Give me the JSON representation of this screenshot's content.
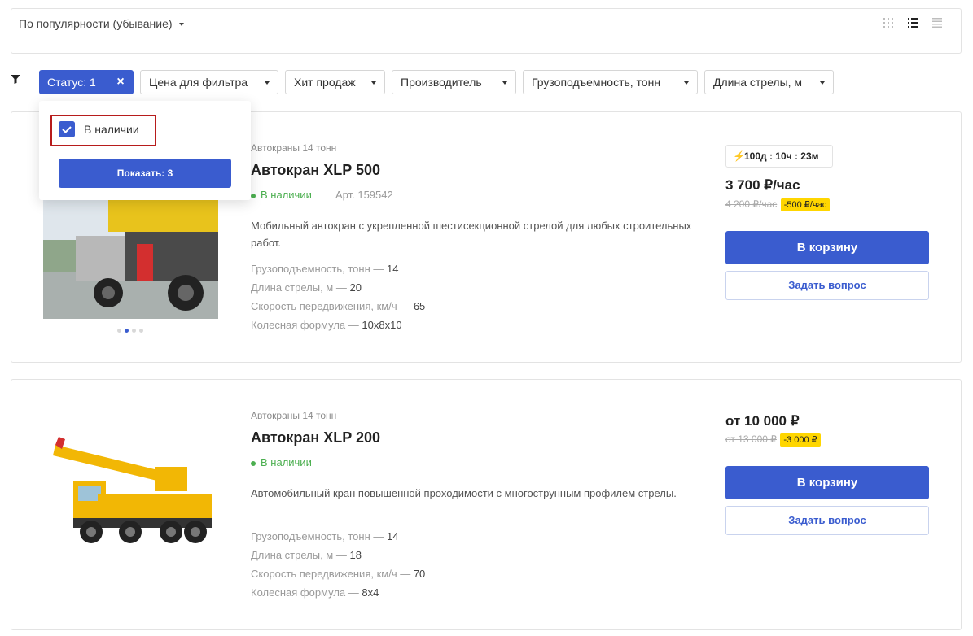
{
  "sort": {
    "label": "По популярности (убывание)"
  },
  "filters": {
    "status_label": "Статус: 1",
    "status_close": "×",
    "chips": [
      "Цена для фильтра",
      "Хит продаж",
      "Производитель",
      "Грузоподъемность, тонн",
      "Длина стрелы, м"
    ]
  },
  "popup": {
    "option_label": "В наличии",
    "show_button": "Показать: 3"
  },
  "products": [
    {
      "category": "Автокраны 14 тонн",
      "title": "Автокран XLP 500",
      "stock": "В наличии",
      "article": "Арт. 159542",
      "description": "Мобильный автокран с укрепленной шестисекционной стрелой для любых строительных работ.",
      "props": [
        {
          "name": "Грузоподъемность, тонн —",
          "value": "14"
        },
        {
          "name": "Длина стрелы, м —",
          "value": "20"
        },
        {
          "name": "Скорость передвижения, км/ч —",
          "value": "65"
        },
        {
          "name": "Колесная формула —",
          "value": "10x8x10"
        }
      ],
      "timer": "100д : 10ч : 23м",
      "price": "3 700 ₽/час",
      "old_price": "4 200 ₽/час",
      "discount": "-500 ₽/час",
      "cart_button": "В корзину",
      "ask_button": "Задать вопрос"
    },
    {
      "category": "Автокраны 14 тонн",
      "title": "Автокран XLP 200",
      "stock": "В наличии",
      "description": "Автомобильный кран повышенной проходимости с многострунным профилем стрелы.",
      "props": [
        {
          "name": "Грузоподъемность, тонн —",
          "value": "14"
        },
        {
          "name": "Длина стрелы, м —",
          "value": "18"
        },
        {
          "name": "Скорость передвижения, км/ч —",
          "value": "70"
        },
        {
          "name": "Колесная формула —",
          "value": "8x4"
        }
      ],
      "price": "от 10 000 ₽",
      "old_price": "от 13 000 ₽",
      "discount": "-3 000 ₽",
      "cart_button": "В корзину",
      "ask_button": "Задать вопрос"
    }
  ],
  "colors": {
    "accent": "#3a5ccf",
    "stock": "#4caf50",
    "discount": "#ffd600",
    "highlight": "#b71c1c"
  }
}
